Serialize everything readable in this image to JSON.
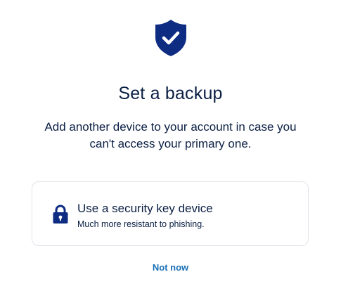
{
  "header": {
    "icon": "shield-check-icon",
    "title": "Set a backup",
    "subtitle": "Add another device to your account in case you can't access your primary one."
  },
  "options": [
    {
      "icon": "lock-icon",
      "title": "Use a security key device",
      "description": "Much more resistant to phishing."
    }
  ],
  "actions": {
    "not_now_label": "Not now"
  },
  "colors": {
    "brand_navy": "#0e2d82",
    "text": "#0b1f44",
    "link": "#1a6fb5",
    "card_border": "#e1e4ea"
  }
}
